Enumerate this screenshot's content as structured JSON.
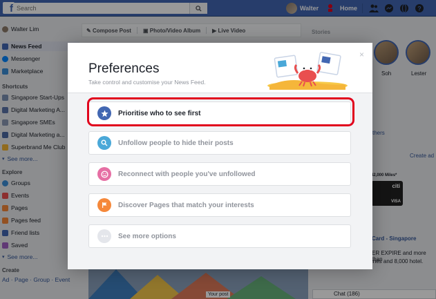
{
  "topbar": {
    "logo": "f",
    "search_placeholder": "Search",
    "user_name": "Walter",
    "home_label": "Home"
  },
  "leftnav": {
    "profile_name": "Walter Lim",
    "main_items": [
      "News Feed",
      "Messenger",
      "Marketplace"
    ],
    "shortcuts_heading": "Shortcuts",
    "shortcuts": [
      "Singapore Start-Ups",
      "Digital Marketing A...",
      "Singapore SMEs",
      "Digital Marketing a...",
      "Superbrand Me Club"
    ],
    "shortcuts_more": "See more...",
    "explore_heading": "Explore",
    "explore": [
      "Groups",
      "Events",
      "Pages",
      "Pages feed",
      "Friend lists",
      "Saved"
    ],
    "explore_more": "See more...",
    "create_heading": "Create",
    "create_links": "Ad · Page · Group · Event"
  },
  "composer": {
    "compose_post": "Compose Post",
    "photo_album": "Photo/Video Album",
    "live_video": "Live Video"
  },
  "rightcol": {
    "stories_title": "Stories",
    "story_names": [
      "Soh",
      "Lester"
    ],
    "others_link": "thers",
    "create_ad": "Create ad",
    "ad_miles": "42,000 Miles*",
    "ad_brand": "citi",
    "ad_visa": "VISA",
    "ad_title": "Card - Singapore",
    "ad_line1": "ER EXPIRE and more than",
    "ad_line2": "ines and 8,000 hotel.",
    "chat_label": "Chat (186)"
  },
  "feed": {
    "your_post": "Your post"
  },
  "modal": {
    "title": "Preferences",
    "subtitle": "Take control and customise your News Feed.",
    "close": "×",
    "options": [
      {
        "label": "Prioritise who to see first",
        "icon": "star-icon",
        "color": "#4267b2"
      },
      {
        "label": "Unfollow people to hide their posts",
        "icon": "search-icon",
        "color": "#4aa8d8"
      },
      {
        "label": "Reconnect with people you've unfollowed",
        "icon": "smile-icon",
        "color": "#e66fa4"
      },
      {
        "label": "Discover Pages that match your interests",
        "icon": "flag-icon",
        "color": "#f5883a"
      },
      {
        "label": "See more options",
        "icon": "more-icon",
        "color": "#d0d3d8"
      }
    ]
  },
  "colors": {
    "fb_blue": "#4267b2",
    "highlight_red": "#e1011c"
  }
}
